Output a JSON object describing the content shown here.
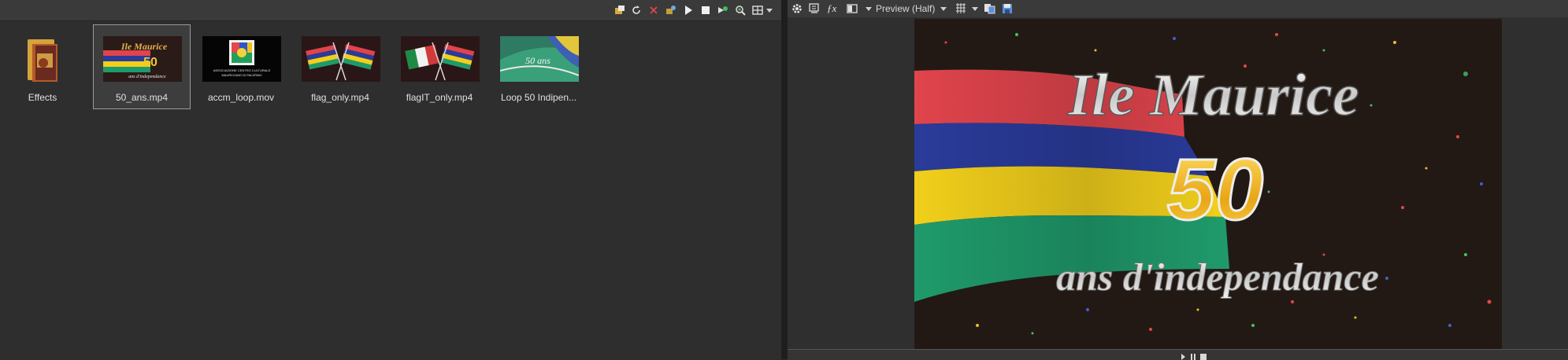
{
  "media": {
    "items": [
      {
        "label": "Effects"
      },
      {
        "label": "50_ans.mp4"
      },
      {
        "label": "accm_loop.mov"
      },
      {
        "label": "flag_only.mp4"
      },
      {
        "label": "flagIT_only.mp4"
      },
      {
        "label": "Loop 50 Indipen..."
      }
    ],
    "thumbs": {
      "fifty_title": "Ile Maurice",
      "fifty_number": "50",
      "fifty_sub": "ans d'independance",
      "accm_line1": "ASSOCIAZIONE CENTRO CULTURALE",
      "accm_line2": "MAURICIANO DI PALERMO",
      "loop_line": "50 ans"
    }
  },
  "preview": {
    "quality": "Preview (Half)",
    "video_title": "Ile Maurice",
    "video_number": "50",
    "video_subtitle": "ans d'independance"
  },
  "colors": {
    "flag_red": "#e0444c",
    "flag_blue": "#2a3b9a",
    "flag_yellow": "#f1cf1b",
    "flag_green": "#1f9a6b",
    "panel_bg": "#2e2e2e",
    "toolbar_bg": "#3a3a3a"
  }
}
